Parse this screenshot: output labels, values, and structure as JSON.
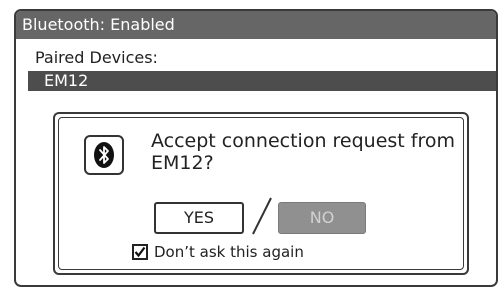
{
  "header": {
    "title": "Bluetooth: Enabled"
  },
  "paired": {
    "label": "Paired Devices:",
    "items": [
      {
        "label": "EM12",
        "selected": true
      }
    ]
  },
  "dialog": {
    "icon": "bluetooth-icon",
    "message": "Accept connection request from EM12?",
    "yes_label": "YES",
    "no_label": "NO",
    "no_disabled": true,
    "dont_ask_label": "Don’t ask this again",
    "dont_ask_checked": true
  },
  "colors": {
    "title_bar": "#666666",
    "selected_row": "#4d4d4d",
    "disabled_button": "#909090"
  }
}
